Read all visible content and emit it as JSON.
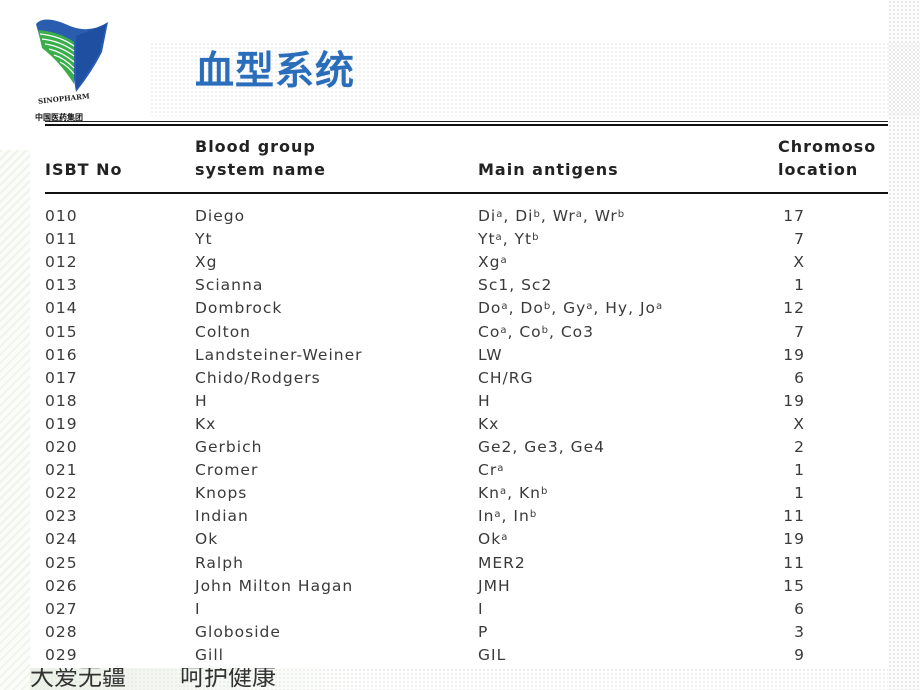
{
  "header": {
    "title": "血型系统",
    "logo": {
      "name": "SINOPHARM",
      "cn_name": "中国医药集团",
      "icon": "sinopharm-logo-icon",
      "colors": {
        "blue": "#2a5db0",
        "green": "#3aae4a"
      }
    },
    "title_color": "#2a6ebb"
  },
  "table": {
    "columns": {
      "isbt_no": "ISBT No",
      "name_line1": "Blood group",
      "name_line2": "system name",
      "antigens": "Main antigens",
      "chrom_line1": "Chromoso",
      "chrom_line2": "location"
    },
    "rows": [
      {
        "no": "010",
        "name": "Diego",
        "antigens": [
          [
            "Di",
            "a"
          ],
          [
            "Di",
            "b"
          ],
          [
            "Wr",
            "a"
          ],
          [
            "Wr",
            "b"
          ]
        ],
        "chromosome": "17"
      },
      {
        "no": "011",
        "name": "Yt",
        "antigens": [
          [
            "Yt",
            "a"
          ],
          [
            "Yt",
            "b"
          ]
        ],
        "chromosome": "7"
      },
      {
        "no": "012",
        "name": "Xg",
        "antigens": [
          [
            "Xg",
            "a"
          ]
        ],
        "chromosome": "X"
      },
      {
        "no": "013",
        "name": "Scianna",
        "antigens": [
          [
            "Sc1",
            ""
          ],
          [
            "Sc2",
            ""
          ]
        ],
        "chromosome": "1"
      },
      {
        "no": "014",
        "name": "Dombrock",
        "antigens": [
          [
            "Do",
            "a"
          ],
          [
            "Do",
            "b"
          ],
          [
            "Gy",
            "a"
          ],
          [
            "Hy",
            ""
          ],
          [
            "Jo",
            "a"
          ]
        ],
        "chromosome": "12"
      },
      {
        "no": "015",
        "name": "Colton",
        "antigens": [
          [
            "Co",
            "a"
          ],
          [
            "Co",
            "b"
          ],
          [
            "Co3",
            ""
          ]
        ],
        "chromosome": "7"
      },
      {
        "no": "016",
        "name": "Landsteiner-Weiner",
        "antigens": [
          [
            "LW",
            ""
          ]
        ],
        "chromosome": "19"
      },
      {
        "no": "017",
        "name": "Chido/Rodgers",
        "antigens": [
          [
            "CH/RG",
            ""
          ]
        ],
        "chromosome": "6"
      },
      {
        "no": "018",
        "name": "H",
        "antigens": [
          [
            "H",
            ""
          ]
        ],
        "chromosome": "19"
      },
      {
        "no": "019",
        "name": "Kx",
        "antigens": [
          [
            "Kx",
            ""
          ]
        ],
        "chromosome": "X"
      },
      {
        "no": "020",
        "name": "Gerbich",
        "antigens": [
          [
            "Ge2",
            ""
          ],
          [
            "Ge3",
            ""
          ],
          [
            "Ge4",
            ""
          ]
        ],
        "chromosome": "2"
      },
      {
        "no": "021",
        "name": "Cromer",
        "antigens": [
          [
            "Cr",
            "a"
          ]
        ],
        "chromosome": "1"
      },
      {
        "no": "022",
        "name": "Knops",
        "antigens": [
          [
            "Kn",
            "a"
          ],
          [
            "Kn",
            "b"
          ]
        ],
        "chromosome": "1"
      },
      {
        "no": "023",
        "name": "Indian",
        "antigens": [
          [
            "In",
            "a"
          ],
          [
            "In",
            "b"
          ]
        ],
        "chromosome": "11"
      },
      {
        "no": "024",
        "name": "Ok",
        "antigens": [
          [
            "Ok",
            "a"
          ]
        ],
        "chromosome": "19"
      },
      {
        "no": "025",
        "name": "Ralph",
        "antigens": [
          [
            "MER2",
            ""
          ]
        ],
        "chromosome": "11"
      },
      {
        "no": "026",
        "name": "John Milton Hagan",
        "antigens": [
          [
            "JMH",
            ""
          ]
        ],
        "chromosome": "15"
      },
      {
        "no": "027",
        "name": "I",
        "antigens": [
          [
            "I",
            ""
          ]
        ],
        "chromosome": "6"
      },
      {
        "no": "028",
        "name": "Globoside",
        "antigens": [
          [
            "P",
            ""
          ]
        ],
        "chromosome": "3"
      },
      {
        "no": "029",
        "name": "Gill",
        "antigens": [
          [
            "GIL",
            ""
          ]
        ],
        "chromosome": "9"
      }
    ]
  },
  "footer": {
    "left": "大爱无疆",
    "right": "呵护健康"
  }
}
